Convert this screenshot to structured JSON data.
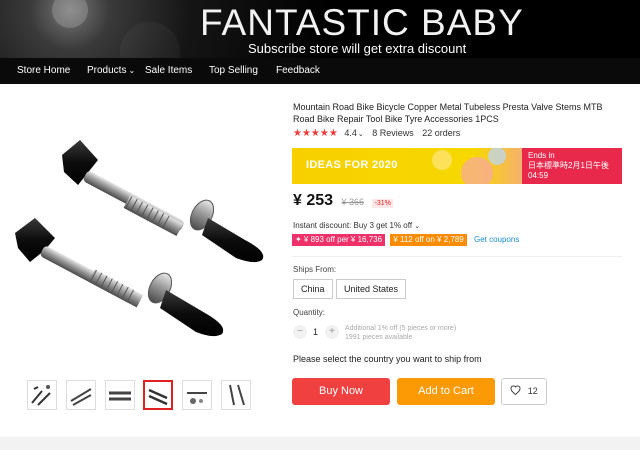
{
  "banner": {
    "title": "FANTASTIC BABY",
    "subtitle": "Subscribe store will get extra discount"
  },
  "nav": {
    "items": [
      {
        "label": "Store Home"
      },
      {
        "label": "Products",
        "has_dropdown": true
      },
      {
        "label": "Sale Items"
      },
      {
        "label": "Top Selling"
      },
      {
        "label": "Feedback"
      }
    ]
  },
  "product": {
    "title": "Mountain Road Bike Bicycle Copper Metal Tubeless Presta Valve Stems MTB Road Bike Repair Tool Bike Tyre Accessories 1PCS",
    "rating": "4.4",
    "stars": "★★★★★",
    "reviews": "8 Reviews",
    "orders": "22 orders",
    "price": "¥ 253",
    "original_price": "¥ 366",
    "discount": "-31%",
    "thumbnail_count": 6,
    "active_thumbnail": 4
  },
  "promo": {
    "label": "IDEAS FOR 2020",
    "ends_label": "Ends in",
    "ends_time": "日本標準時2月1日午後04:59"
  },
  "discounts": {
    "instant": "Instant discount: Buy 3 get 1% off",
    "coupon1": "✦ ¥ 893 off per ¥ 16,736",
    "coupon2": "¥ 112 off on ¥ 2,789",
    "get_coupons": "Get coupons"
  },
  "shipping": {
    "label": "Ships From:",
    "options": [
      "China",
      "United States"
    ]
  },
  "quantity": {
    "label": "Quantity:",
    "value": "1",
    "minus": "−",
    "plus": "+",
    "note1": "Additional 1% off (5 pieces or more)",
    "note2": "1991 pieces available"
  },
  "actions": {
    "select_country": "Please select the country you want to ship from",
    "buy_now": "Buy Now",
    "add_to_cart": "Add to Cart",
    "wishlist_count": "12"
  },
  "colors": {
    "accent_red": "#f14040",
    "cart_orange": "#fb9a05",
    "promo_yellow": "#f8d000",
    "promo_red": "#e8294c",
    "link_blue": "#1a8fd8"
  }
}
